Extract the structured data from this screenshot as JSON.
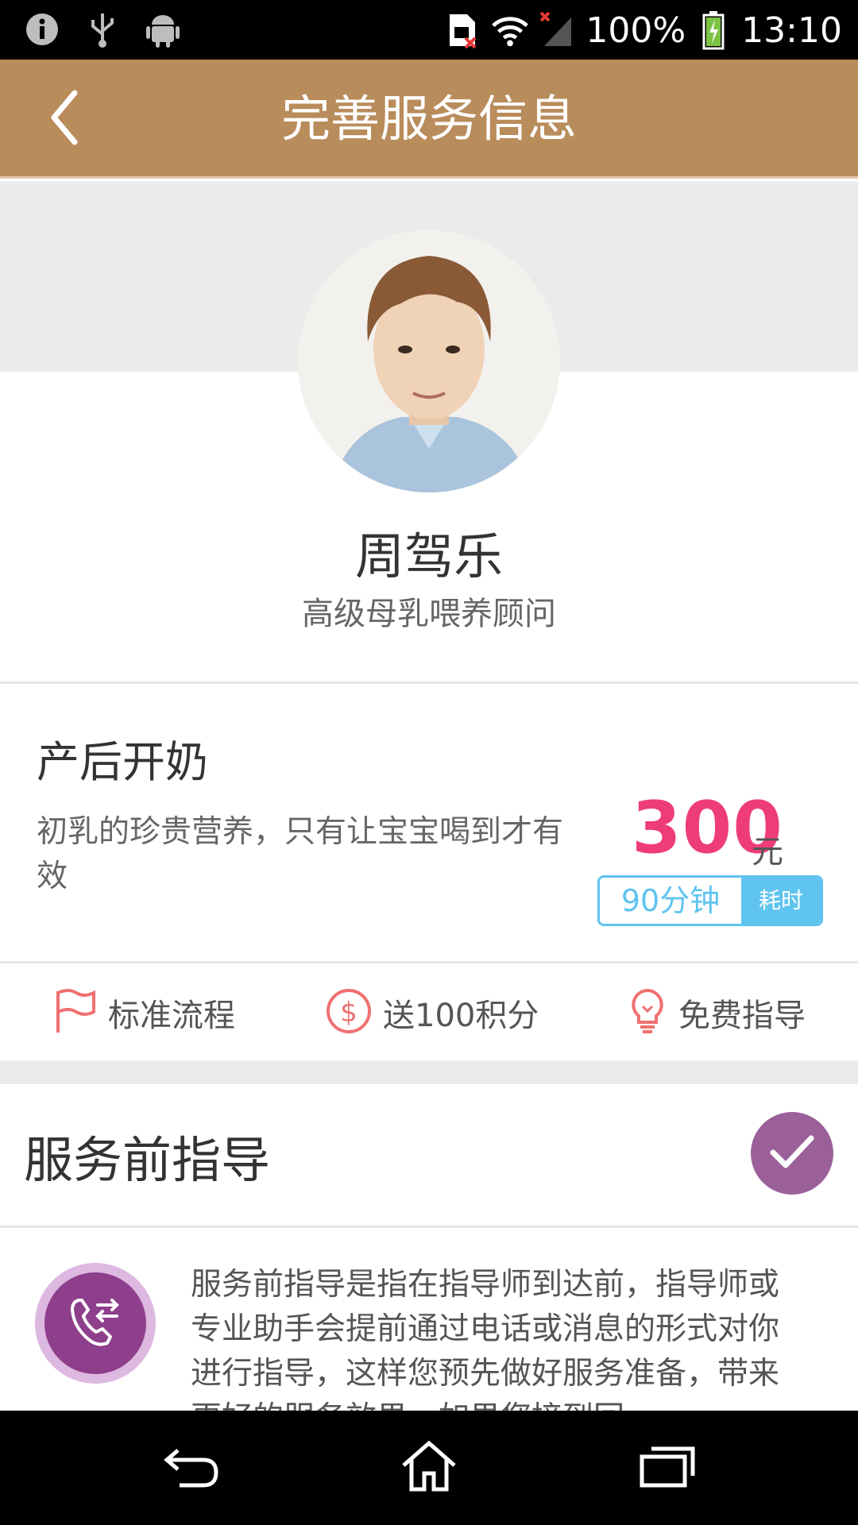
{
  "status_bar": {
    "battery": "100%",
    "time": "13:10",
    "icons": [
      "info-icon",
      "usb-icon",
      "android-icon",
      "sim-error-icon",
      "wifi-icon",
      "signal-icon",
      "battery-charging-icon"
    ]
  },
  "header": {
    "title": "完善服务信息",
    "back_icon": "back-arrow-icon"
  },
  "profile": {
    "name": "周驾乐",
    "role": "高级母乳喂养顾问"
  },
  "service": {
    "name": "产后开奶",
    "description": "初乳的珍贵营养，只有让宝宝喝到才有效",
    "price": "300",
    "unit": "元",
    "duration_value": "90分钟",
    "duration_label": "耗时"
  },
  "features": [
    {
      "icon": "flag-icon",
      "label": "标准流程"
    },
    {
      "icon": "dollar-coin-icon",
      "label": "送100积分"
    },
    {
      "icon": "lightbulb-icon",
      "label": "免费指导"
    }
  ],
  "guidance": {
    "title": "服务前指导",
    "checked": true,
    "text": "服务前指导是指在指导师到达前，指导师或专业助手会提前通过电话或消息的形式对你进行指导，这样您预先做好服务准备，带来更好的服务效果，如果您接到回"
  },
  "colors": {
    "app_bar": "#b98c5b",
    "price": "#ee3d76",
    "duration": "#5fc4ef",
    "accent_purple": "#9b5f99",
    "feature_icon": "#f07070"
  }
}
